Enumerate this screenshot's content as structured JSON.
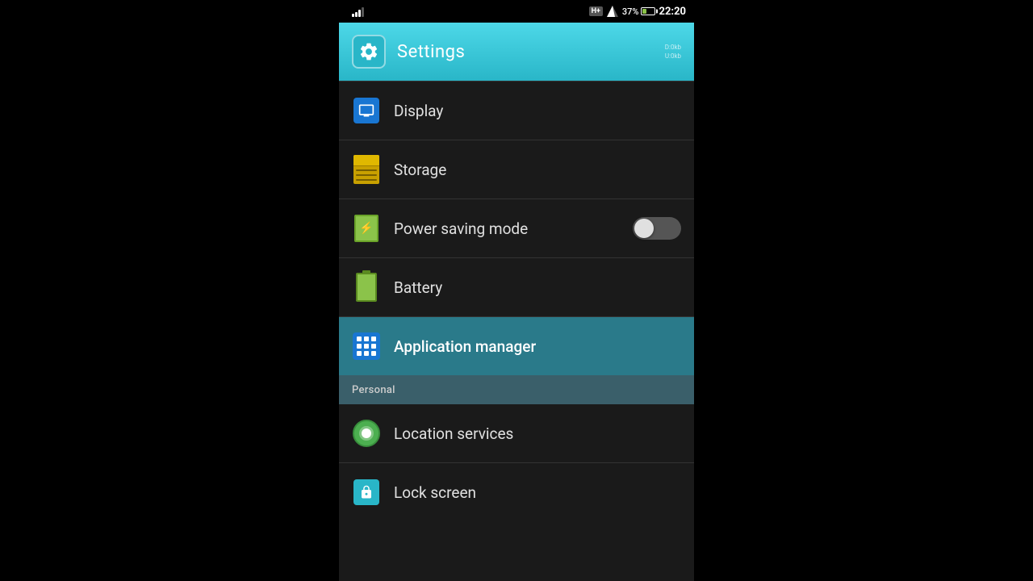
{
  "statusBar": {
    "time": "22:20",
    "battery_percent": "37%",
    "network_type": "H+",
    "download_speed": "D:0kb",
    "upload_speed": "U:0kb"
  },
  "header": {
    "title": "Settings",
    "icon": "gear-icon",
    "data_down": "D:0kb",
    "data_up": "U:0kb"
  },
  "menuItems": [
    {
      "id": "display",
      "label": "Display",
      "icon": "display-icon",
      "active": false
    },
    {
      "id": "storage",
      "label": "Storage",
      "icon": "storage-icon",
      "active": false
    },
    {
      "id": "power_saving",
      "label": "Power saving mode",
      "icon": "power-icon",
      "hasToggle": true,
      "toggleOn": false,
      "active": false
    },
    {
      "id": "battery",
      "label": "Battery",
      "icon": "battery-icon",
      "active": false
    },
    {
      "id": "app_manager",
      "label": "Application manager",
      "icon": "apps-icon",
      "active": true
    }
  ],
  "sectionHeader": {
    "label": "Personal"
  },
  "extraItems": [
    {
      "id": "location",
      "label": "Location services",
      "icon": "location-icon"
    },
    {
      "id": "lock_screen",
      "label": "Lock screen",
      "icon": "lock-icon"
    }
  ]
}
